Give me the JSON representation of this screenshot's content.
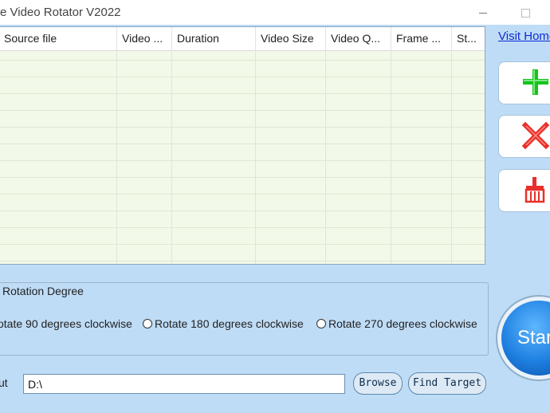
{
  "window": {
    "title": "e Video Rotator V2022"
  },
  "table": {
    "columns": [
      "Source file",
      "Video ...",
      "Duration",
      "Video Size",
      "Video Q...",
      "Frame ...",
      "St..."
    ]
  },
  "side": {
    "visit_link": "Visit Homepage",
    "add_icon": "plus-icon",
    "delete_icon": "x-icon",
    "clear_icon": "broom-icon"
  },
  "rotation": {
    "group_label": "Rotation Degree",
    "options": [
      "otate 90 degrees clockwise",
      "Rotate 180 degrees clockwise",
      "Rotate 270 degrees clockwise"
    ]
  },
  "output": {
    "label": "ut",
    "path": "D:\\",
    "browse_label": "Browse",
    "find_label": "Find Target"
  },
  "start": {
    "label": "Start"
  },
  "colors": {
    "background": "#bfdcf6",
    "grid": "#f2f9e8",
    "link": "#0b2bd6",
    "add": "#16c41c",
    "delete": "#e8302a"
  }
}
